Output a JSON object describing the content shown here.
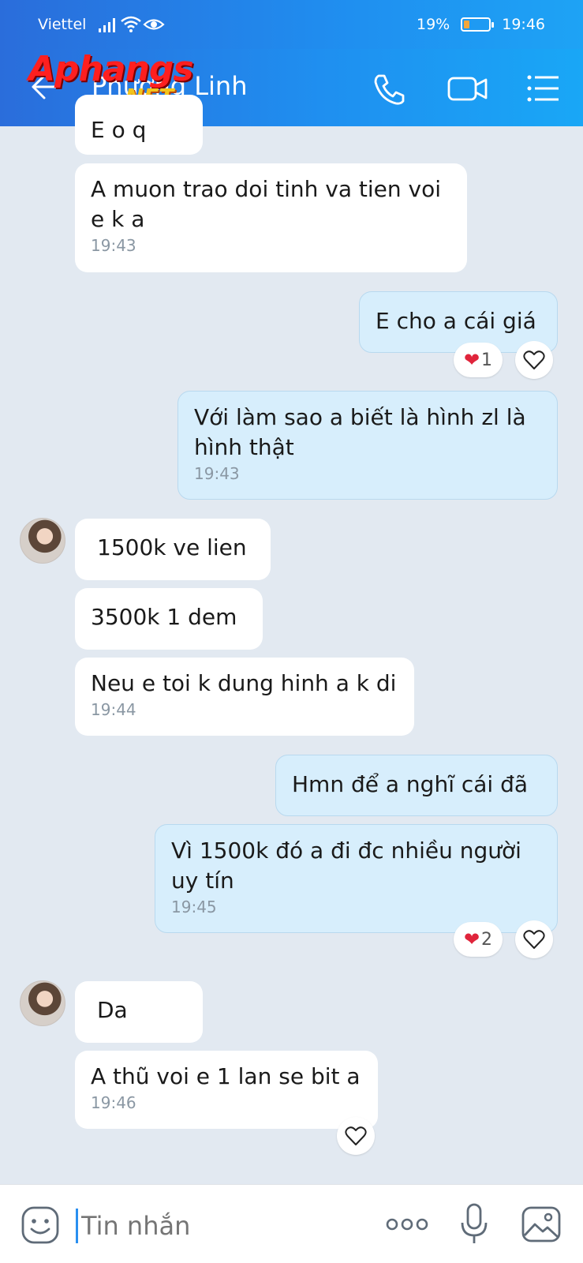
{
  "status_bar": {
    "carrier": "Viettel",
    "battery": "19%",
    "time": "19:46"
  },
  "header": {
    "contact_name": "Phương Linh",
    "watermark_logo": "Aphangs",
    "watermark_suffix": ".NET"
  },
  "messages": [
    {
      "dir": "in",
      "text": "E o q",
      "time": ""
    },
    {
      "dir": "in",
      "text": "A muon trao doi tinh va tien voi e k a",
      "time": "19:43"
    },
    {
      "dir": "out",
      "text": "E cho a cái giá",
      "time": ""
    },
    {
      "dir": "out",
      "text": "Với làm sao a biết là hình zl là hình thật",
      "time": "19:43"
    },
    {
      "dir": "in",
      "text": "1500k ve lien",
      "time": ""
    },
    {
      "dir": "in",
      "text": "3500k 1 dem",
      "time": ""
    },
    {
      "dir": "in",
      "text": "Neu e toi k dung hinh a k di",
      "time": "19:44"
    },
    {
      "dir": "out",
      "text": "Hmn để a nghĩ cái đã",
      "time": ""
    },
    {
      "dir": "out",
      "text": "Vì 1500k đó a đi đc nhiều người uy tín",
      "time": "19:45"
    },
    {
      "dir": "in",
      "text": "Da",
      "time": ""
    },
    {
      "dir": "in",
      "text": "A thũ voi e 1 lan se bit a",
      "time": "19:46"
    }
  ],
  "reactions": [
    {
      "count": "1"
    },
    {
      "count": "2"
    }
  ],
  "input": {
    "placeholder": "Tin nhắn"
  },
  "colors": {
    "header": "#1f8ff0",
    "bubble_out": "#d7eefc",
    "bubble_in": "#ffffff",
    "chat_bg": "#e2e9f1",
    "heart": "#e0243b"
  },
  "icons": {
    "back": "back-arrow-icon",
    "call": "phone-icon",
    "video": "video-camera-icon",
    "menu": "menu-list-icon",
    "emoji": "sticker-icon",
    "more": "more-dots-icon",
    "mic": "microphone-icon",
    "image": "image-icon",
    "like": "heart-outline-icon"
  }
}
